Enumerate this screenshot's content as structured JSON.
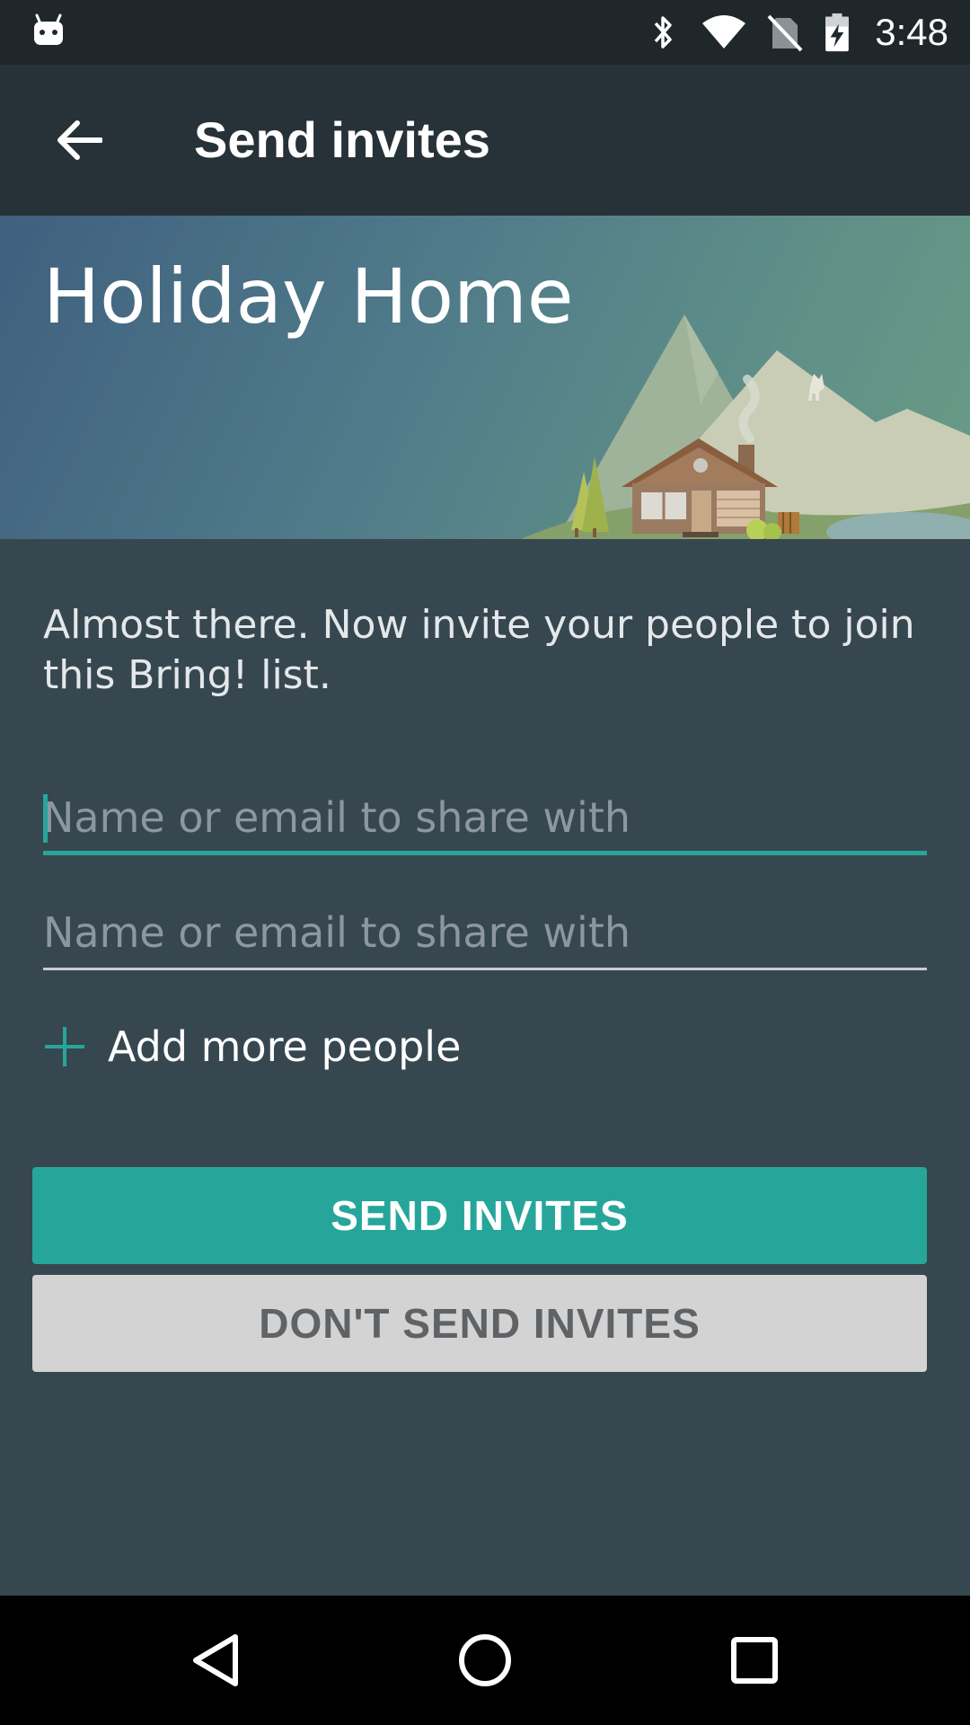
{
  "status_bar": {
    "time": "3:48",
    "left_icon": "android-notification-icon",
    "right_icons": [
      "bluetooth-icon",
      "wifi-icon",
      "no-sim-icon",
      "battery-charging-icon"
    ]
  },
  "app_bar": {
    "back_icon": "arrow-back-icon",
    "title": "Send invites"
  },
  "banner": {
    "list_name": "Holiday Home",
    "illustration": "mountain-house-illustration"
  },
  "content": {
    "intro": "Almost there. Now invite your people to join this Bring! list.",
    "fields": [
      {
        "placeholder": "Name or email to share with",
        "value": "",
        "focused": true
      },
      {
        "placeholder": "Name or email to share with",
        "value": "",
        "focused": false
      }
    ],
    "add_more_label": "Add more people",
    "add_more_icon": "plus-icon",
    "send_button": "SEND INVITES",
    "dont_send_button": "DON'T SEND INVITES"
  },
  "nav_bar": {
    "icons": [
      "nav-back-icon",
      "nav-home-icon",
      "nav-recents-icon"
    ]
  },
  "colors": {
    "accent": "#26a69a",
    "background": "#37474f",
    "app_bar": "#263238",
    "secondary_button": "#d3d3d3"
  }
}
